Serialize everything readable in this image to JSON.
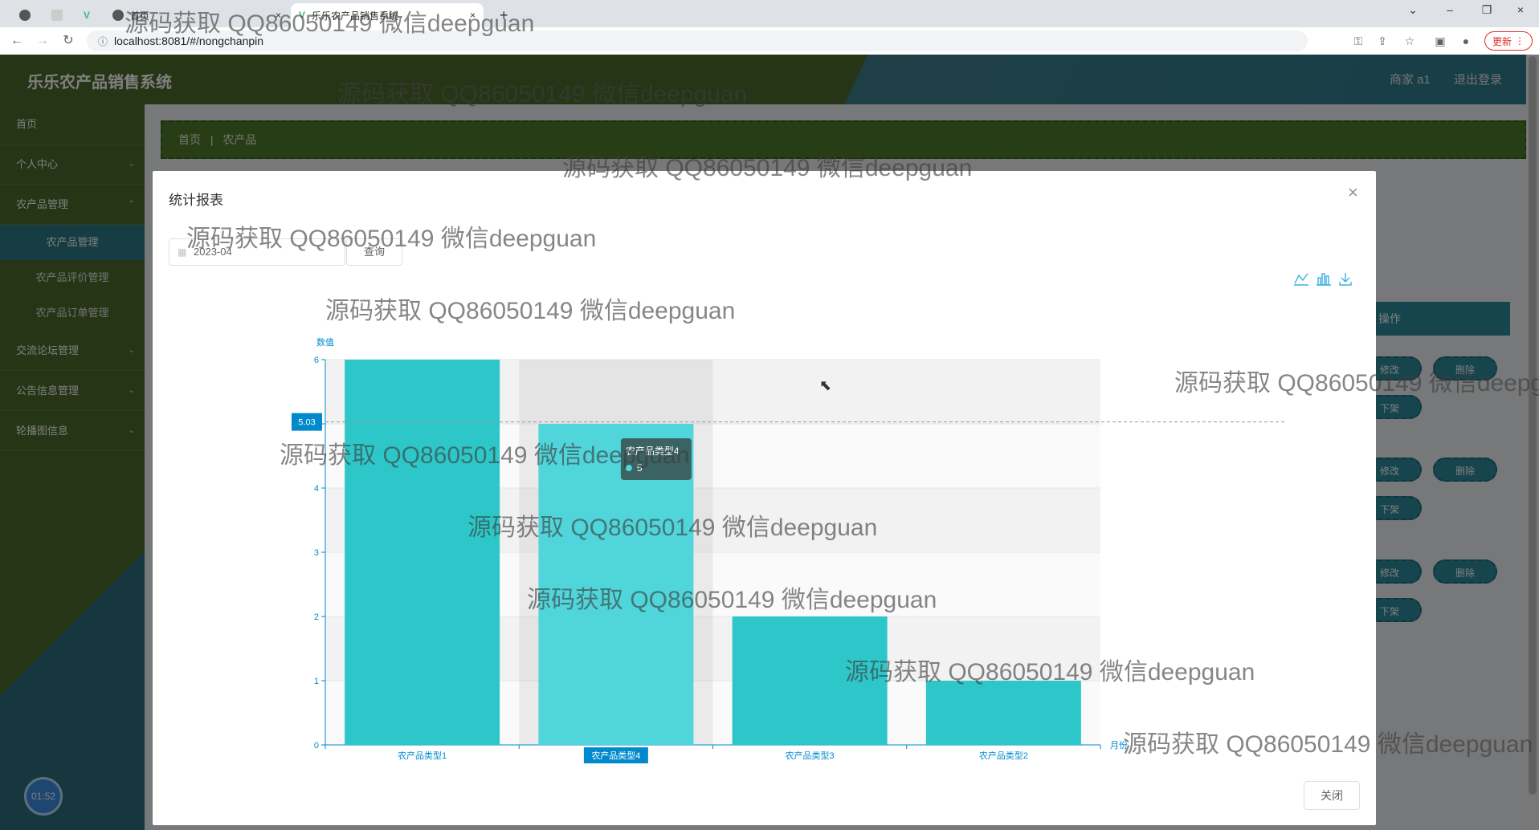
{
  "browser": {
    "tabs": [
      "首页",
      "乐乐农产品销售系统"
    ],
    "url": "localhost:8081/#/nongchanpin",
    "update_label": "更新"
  },
  "app": {
    "title": "乐乐农产品销售系统",
    "user_label": "商家 a1",
    "logout_label": "退出登录"
  },
  "sidebar": {
    "items": [
      {
        "label": "首页"
      },
      {
        "label": "个人中心"
      },
      {
        "label": "农产品管理"
      },
      {
        "label": "交流论坛管理"
      },
      {
        "label": "公告信息管理"
      },
      {
        "label": "轮播图信息"
      }
    ],
    "subitems": [
      "农产品管理",
      "农产品评价管理",
      "农产品订单管理"
    ]
  },
  "breadcrumb": {
    "home": "首页",
    "sep": "|",
    "current": "农产品"
  },
  "table": {
    "ops_header": "操作",
    "edit_label": "修改",
    "delete_label": "删除",
    "offshelf_label": "下架"
  },
  "clock": "01:52",
  "modal": {
    "title": "统计报表",
    "close_x": "×",
    "date_value": "2023-04",
    "query_label": "查询",
    "close_label": "关闭"
  },
  "chart_data": {
    "type": "bar",
    "categories": [
      "农产品类型1",
      "农产品类型4",
      "农产品类型3",
      "农产品类型2"
    ],
    "values": [
      6,
      5,
      2,
      1
    ],
    "ylabel": "数值",
    "xlabel": "月份",
    "ylim": [
      0,
      6
    ],
    "yticks": [
      "0",
      "1",
      "2",
      "3",
      "4",
      "5",
      "6"
    ],
    "bar_color": "#2ec7c9",
    "highlight_color": "#50d6da",
    "hover_category": "农产品类型4",
    "pointer_value": "5.03",
    "tooltip": {
      "name": "农产品类型4",
      "value": "5"
    },
    "grid": true
  },
  "watermark": "源码获取 QQ86050149 微信deepguan"
}
